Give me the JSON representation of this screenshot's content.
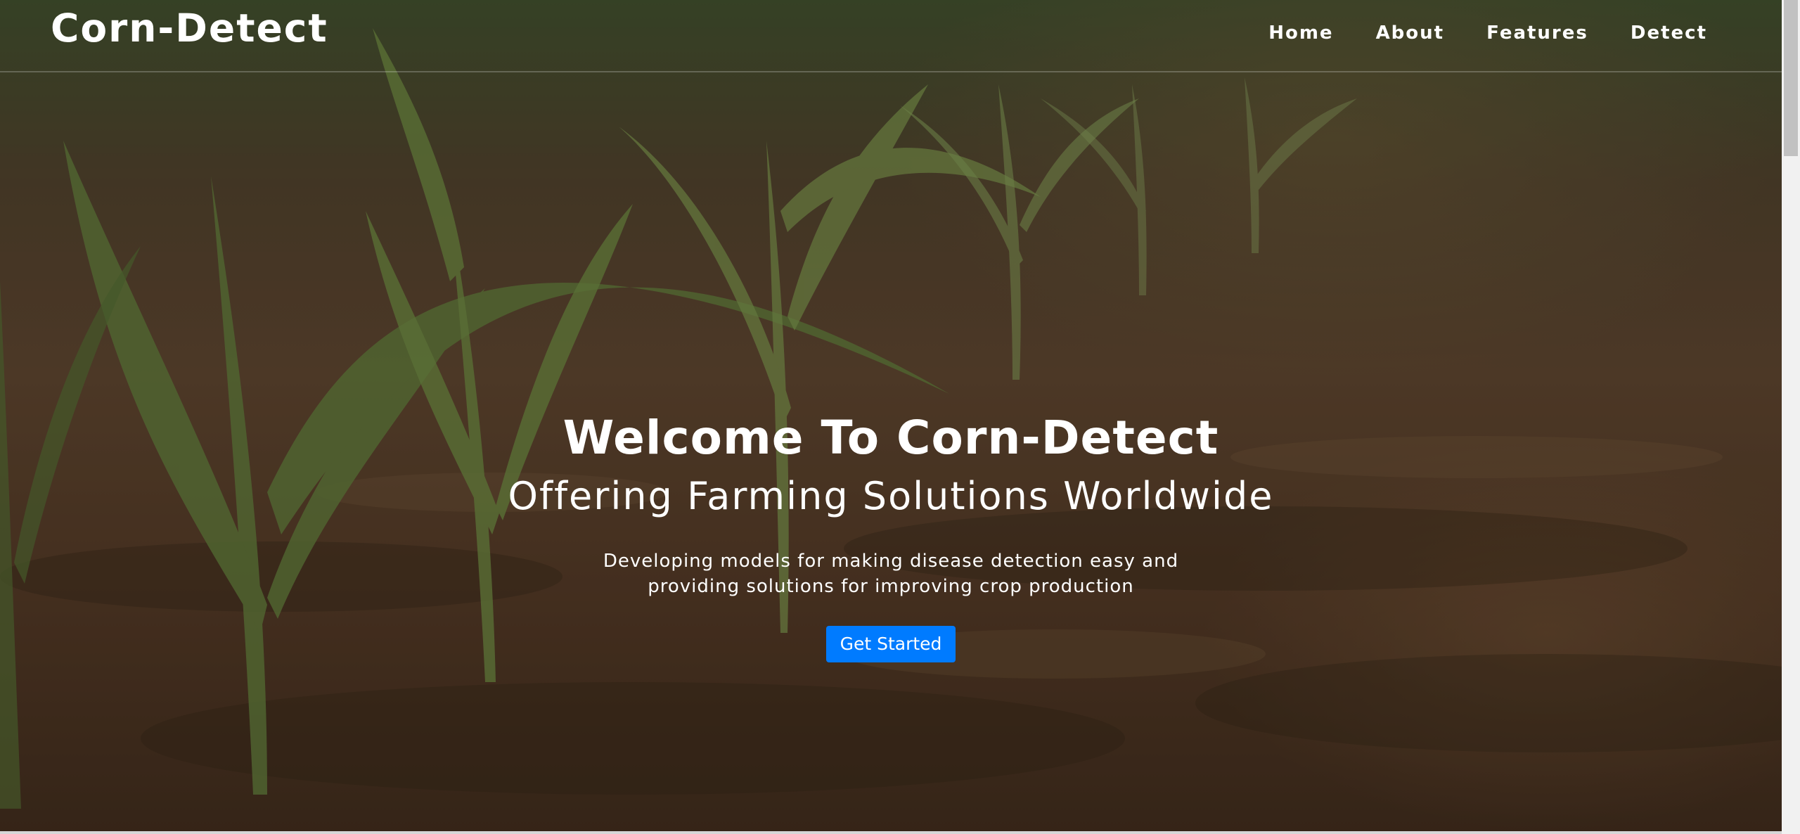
{
  "brand": {
    "name": "Corn-Detect"
  },
  "nav": {
    "items": [
      {
        "label": "Home"
      },
      {
        "label": "About"
      },
      {
        "label": "Features"
      },
      {
        "label": "Detect"
      }
    ]
  },
  "hero": {
    "title": "Welcome To Corn-Detect",
    "subtitle": "Offering Farming Solutions Worldwide",
    "description": "Developing models for making disease detection easy and providing solutions for improving crop production",
    "cta_label": "Get Started"
  },
  "colors": {
    "accent": "#007bff",
    "text": "#ffffff"
  },
  "icons": {
    "background": "corn-field-photo"
  }
}
